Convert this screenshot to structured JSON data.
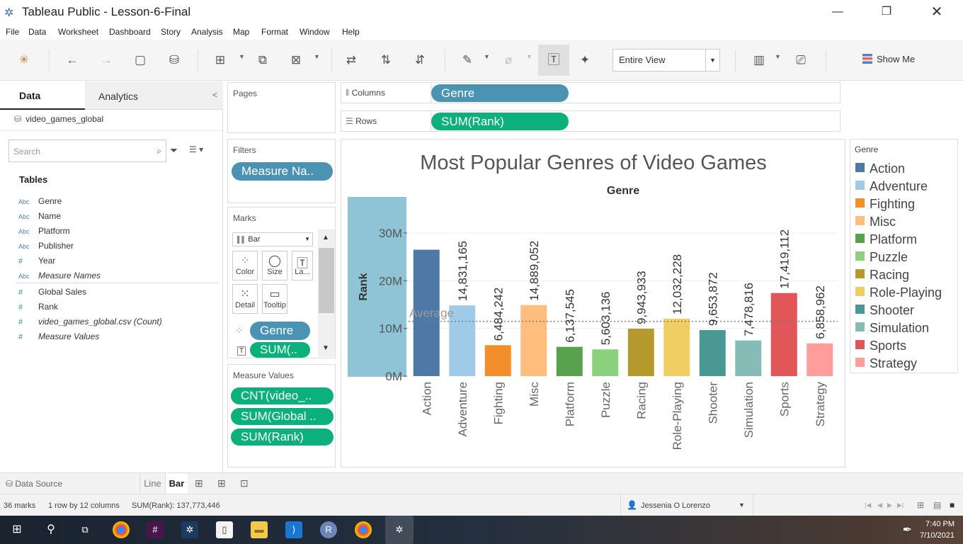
{
  "window": {
    "title": "Tableau Public - Lesson-6-Final"
  },
  "menu": [
    "File",
    "Data",
    "Worksheet",
    "Dashboard",
    "Story",
    "Analysis",
    "Map",
    "Format",
    "Window",
    "Help"
  ],
  "toolbar": {
    "fit": "Entire View",
    "show_me": "Show Me"
  },
  "data_pane": {
    "tab_data": "Data",
    "tab_analytics": "Analytics",
    "datasource": "video_games_global",
    "search_placeholder": "Search",
    "tables_heading": "Tables",
    "dim_type": "Abc",
    "fields": [
      {
        "type": "Abc",
        "name": "Genre"
      },
      {
        "type": "Abc",
        "name": "Name"
      },
      {
        "type": "Abc",
        "name": "Platform"
      },
      {
        "type": "Abc",
        "name": "Publisher"
      },
      {
        "type": "#",
        "name": "Year"
      },
      {
        "type": "Abc",
        "name": "Measure Names"
      },
      {
        "type": "#",
        "name": "Global Sales"
      },
      {
        "type": "#",
        "name": "Rank"
      },
      {
        "type": "#",
        "name": "video_games_global.csv (Count)"
      },
      {
        "type": "#",
        "name": "Measure Values"
      }
    ]
  },
  "pages": {
    "title": "Pages"
  },
  "filters": {
    "title": "Filters",
    "pill": "Measure Na.."
  },
  "marks": {
    "title": "Marks",
    "type": "Bar",
    "buttons": {
      "color": "Color",
      "size": "Size",
      "label": "La...",
      "detail": "Detail",
      "tooltip": "Tooltip"
    },
    "pills": {
      "genre": "Genre",
      "sum": "SUM(.."
    }
  },
  "measure_values": {
    "title": "Measure Values",
    "pills": [
      "CNT(video_..",
      "SUM(Global ..",
      "SUM(Rank)"
    ]
  },
  "shelves": {
    "columns_label": "Columns",
    "columns_pill": "Genre",
    "rows_label": "Rows",
    "rows_pill": "SUM(Rank)"
  },
  "chart_data": {
    "type": "bar",
    "title": "Most Popular Genres of Video Games",
    "column_header": "Genre",
    "ylabel": "Rank",
    "ylim": [
      0,
      34000000
    ],
    "yticks": [
      "0M",
      "10M",
      "20M",
      "30M"
    ],
    "ytick_values": [
      0,
      10000000,
      20000000,
      30000000
    ],
    "categories": [
      "Action",
      "Adventure",
      "Fighting",
      "Misc",
      "Platform",
      "Puzzle",
      "Racing",
      "Role-Playing",
      "Shooter",
      "Simulation",
      "Sports",
      "Strategy"
    ],
    "values": [
      26500000,
      14831165,
      6484242,
      14889052,
      6137545,
      5603136,
      9943933,
      12032228,
      9653872,
      7478816,
      17419112,
      6858962
    ],
    "labels": [
      "",
      "14,831,165",
      "6,484,242",
      "14,889,052",
      "6,137,545",
      "5,603,136",
      "9,943,933",
      "12,032,228",
      "9,653,872",
      "7,478,816",
      "17,419,112",
      "6,858,962"
    ],
    "colors": [
      "#4e79a7",
      "#a0cbe8",
      "#f28e2b",
      "#ffbe7d",
      "#59a14f",
      "#8cd17d",
      "#b6992d",
      "#f1ce63",
      "#499894",
      "#86bcb6",
      "#e15759",
      "#ff9d9a"
    ],
    "reference_line": {
      "label": "Average",
      "value": 11481121
    },
    "grid": true,
    "legend_placement": "right"
  },
  "legend": {
    "title": "Genre",
    "items": [
      "Action",
      "Adventure",
      "Fighting",
      "Misc",
      "Platform",
      "Puzzle",
      "Racing",
      "Role-Playing",
      "Shooter",
      "Simulation",
      "Sports",
      "Strategy"
    ]
  },
  "sheets": {
    "data_source": "Data Source",
    "tabs": [
      "Line",
      "Bar"
    ],
    "active": "Bar"
  },
  "status": {
    "marks": "36 marks",
    "dims": "1 row by 12 columns",
    "sum": "SUM(Rank): 137,773,446",
    "user": "Jessenia O Lorenzo"
  },
  "taskbar": {
    "time": "7:40 PM",
    "date": "7/10/2021"
  }
}
